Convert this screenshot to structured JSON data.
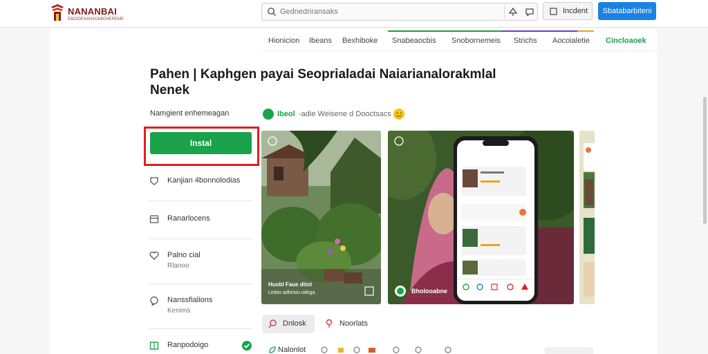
{
  "header": {
    "brand_name": "NANANBAI",
    "brand_tagline": "EBOIDENANSOMIONEREME",
    "search_placeholder": "Gednedriransaks",
    "secondary_button": "Incdent",
    "primary_button": "Sbatabarbiteni"
  },
  "tabs": [
    {
      "label": "Hionicion"
    },
    {
      "label": "Ibeans"
    },
    {
      "label": "Bexhiboke"
    },
    {
      "label": "Snabeaocbis"
    },
    {
      "label": "Snobornemeis"
    },
    {
      "label": "Strichs"
    },
    {
      "label": "Aocoialetie"
    },
    {
      "label": "Cincloaoek"
    }
  ],
  "app": {
    "title": "Pahen | Kaphgen payai Seoprialadai Naiarianalorakmlal Nenek",
    "install_caption": "Namgient enhemeagan",
    "install_label": "Instal",
    "badge_label": "Ibeol",
    "badge_desc": "-adie Weisene d Dooctsacs"
  },
  "sidebar": {
    "items": [
      {
        "label": "Kanjian 4bonnolodias",
        "sub": ""
      },
      {
        "label": "Ranarlocens",
        "sub": ""
      },
      {
        "label": "Palno cial",
        "sub": "Rlanoo"
      },
      {
        "label": "Nanssfialions",
        "sub": "Kenims"
      },
      {
        "label": "Ranpodoigo",
        "sub": ""
      }
    ]
  },
  "screenshots": [
    {
      "caption": "Huobl Faue ditot",
      "subcaption": "Ledso adlonou odirga"
    },
    {
      "caption": "Bholooabne"
    }
  ],
  "chips": [
    {
      "label": "Dnlosk"
    },
    {
      "label": "Noorlats"
    }
  ],
  "footer": {
    "label": "Nalonlot"
  },
  "colors": {
    "install_green": "#1aa34a",
    "primary_blue": "#1a82e2",
    "highlight_red": "#e11d1d",
    "brand_red": "#7a1d12"
  }
}
